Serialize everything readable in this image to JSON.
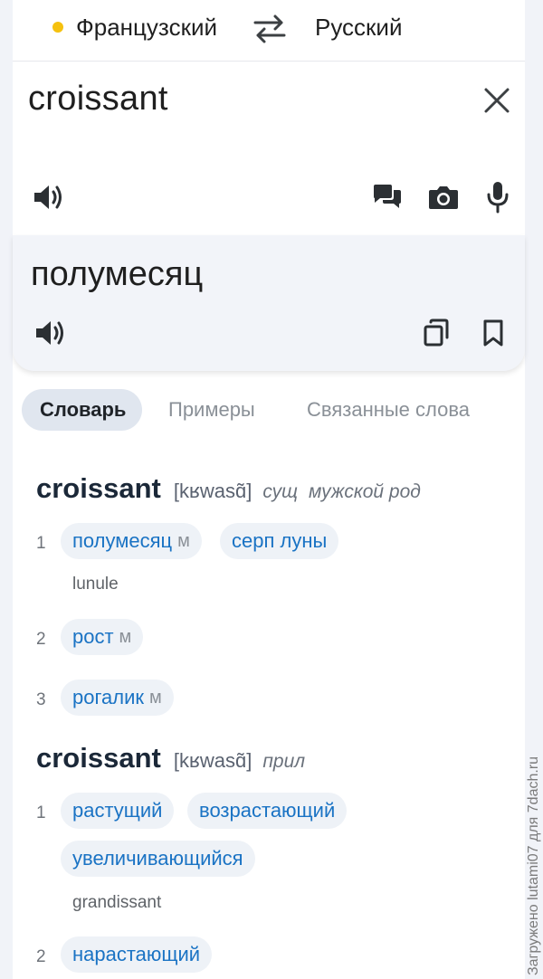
{
  "languages": {
    "source": "Французский",
    "target": "Русский",
    "source_dot_color": "#f5c10f"
  },
  "input": {
    "text": "croissant"
  },
  "output": {
    "text": "полумесяц"
  },
  "tabs": [
    {
      "label": "Словарь",
      "active": true
    },
    {
      "label": "Примеры",
      "active": false
    },
    {
      "label": "Связанные слова",
      "active": false
    }
  ],
  "dictionary": [
    {
      "word": "croissant",
      "ipa": "[kʁwasɑ̃]",
      "pos": [
        "сущ",
        "мужской род"
      ],
      "senses": [
        {
          "num": "1",
          "translations": [
            {
              "text": "полумесяц",
              "gender": "м"
            },
            {
              "text": "серп луны",
              "gender": ""
            }
          ],
          "example": "lunule"
        },
        {
          "num": "2",
          "translations": [
            {
              "text": "рост",
              "gender": "м"
            }
          ],
          "example": ""
        },
        {
          "num": "3",
          "translations": [
            {
              "text": "рогалик",
              "gender": "м"
            }
          ],
          "example": ""
        }
      ]
    },
    {
      "word": "croissant",
      "ipa": "[kʁwasɑ̃]",
      "pos": [
        "прил"
      ],
      "senses": [
        {
          "num": "1",
          "translations": [
            {
              "text": "растущий",
              "gender": ""
            },
            {
              "text": "возрастающий",
              "gender": ""
            },
            {
              "text": "увеличивающийся",
              "gender": ""
            }
          ],
          "example": "grandissant"
        },
        {
          "num": "2",
          "translations": [
            {
              "text": "нарастающий",
              "gender": ""
            }
          ],
          "example": ""
        }
      ]
    }
  ],
  "watermark": "Загружено lutami07 для 7dach.ru",
  "colors": {
    "accent": "#1a73c4",
    "chip_bg": "#eef2f7",
    "output_bg": "#f2f4f9"
  }
}
